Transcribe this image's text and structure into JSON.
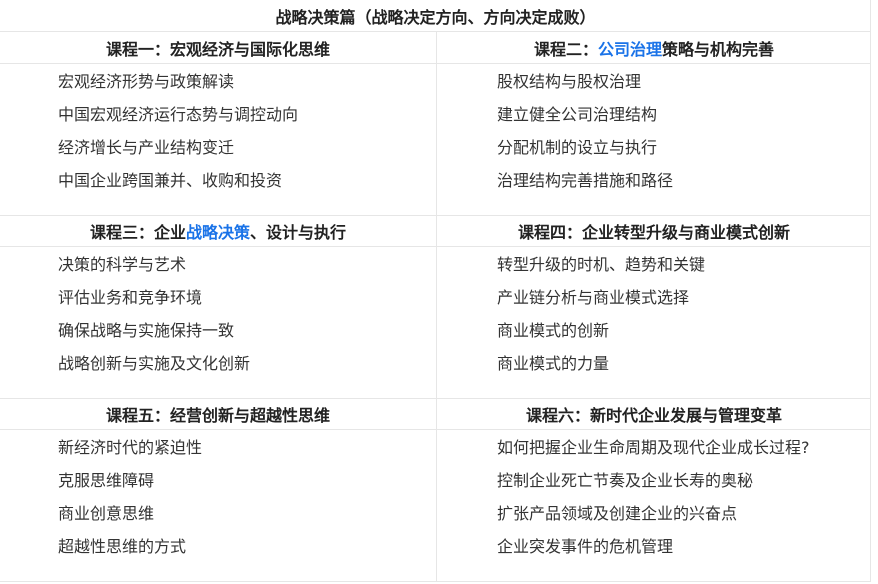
{
  "title": "战略决策篇（战略决定方向、方向决定成败）",
  "highlight_color": "#1a73e8",
  "courses": [
    {
      "title_pre": "课程一：宏观经济与国际化思维",
      "title_hl": "",
      "title_post": "",
      "items": [
        "宏观经济形势与政策解读",
        "中国宏观经济运行态势与调控动向",
        "经济增长与产业结构变迁",
        "中国企业跨国兼并、收购和投资"
      ]
    },
    {
      "title_pre": "课程二：",
      "title_hl": "公司治理",
      "title_post": "策略与机构完善",
      "items": [
        "股权结构与股权治理",
        "建立健全公司治理结构",
        "分配机制的设立与执行",
        "治理结构完善措施和路径"
      ]
    },
    {
      "title_pre": "课程三：企业",
      "title_hl": "战略决策",
      "title_post": "、设计与执行",
      "items": [
        "决策的科学与艺术",
        "评估业务和竞争环境",
        "确保战略与实施保持一致",
        "战略创新与实施及文化创新"
      ]
    },
    {
      "title_pre": "课程四：企业转型升级与商业模式创新",
      "title_hl": "",
      "title_post": "",
      "items": [
        "转型升级的时机、趋势和关键",
        "产业链分析与商业模式选择",
        "商业模式的创新",
        "商业模式的力量"
      ]
    },
    {
      "title_pre": "课程五：经营创新与超越性思维",
      "title_hl": "",
      "title_post": "",
      "items": [
        "新经济时代的紧迫性",
        "克服思维障碍",
        "商业创意思维",
        "超越性思维的方式"
      ]
    },
    {
      "title_pre": "课程六：新时代企业发展与管理变革",
      "title_hl": "",
      "title_post": "",
      "items": [
        "如何把握企业生命周期及现代企业成长过程?",
        "控制企业死亡节奏及企业长寿的奥秘",
        "扩张产品领域及创建企业的兴奋点",
        "企业突发事件的危机管理"
      ]
    }
  ]
}
